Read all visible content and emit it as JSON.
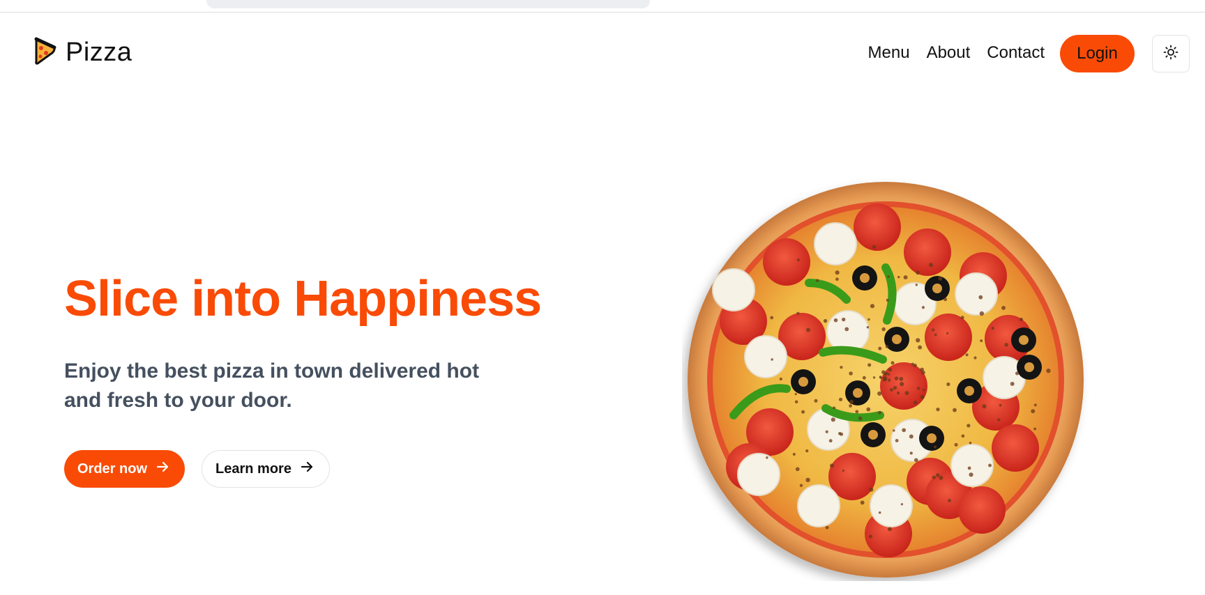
{
  "brand": {
    "name": "Pizza",
    "logo_icon": "pizza-slice-icon"
  },
  "nav": {
    "links": [
      {
        "label": "Menu"
      },
      {
        "label": "About"
      },
      {
        "label": "Contact"
      }
    ],
    "login_label": "Login",
    "theme_icon": "sun-icon"
  },
  "hero": {
    "title": "Slice into Happiness",
    "subtitle": "Enjoy the best pizza in town delivered hot and fresh to your door.",
    "primary_cta": "Order now",
    "secondary_cta": "Learn more",
    "image_subject": "pizza-icon"
  },
  "colors": {
    "accent": "#f94b06",
    "subtitle": "#45505f",
    "text": "#111111"
  }
}
